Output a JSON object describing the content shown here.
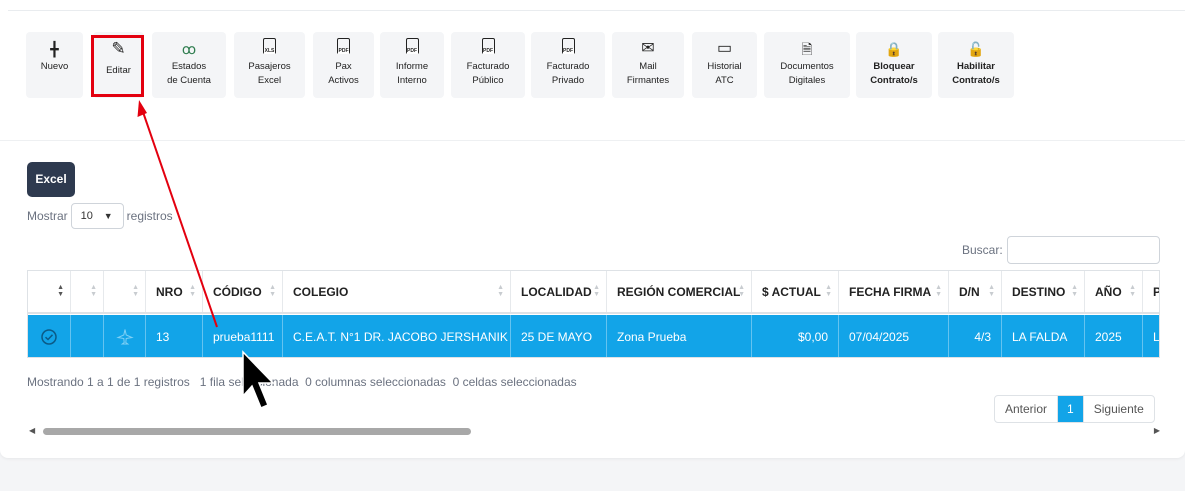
{
  "toolbar": [
    {
      "label": "Nuevo",
      "icon": "plus-icon",
      "glyph": "╋"
    },
    {
      "label": "Editar",
      "icon": "pencil-icon",
      "glyph": "✎"
    },
    {
      "label": "Estados\nde Cuenta",
      "icon": "users-icon",
      "glyph": "ꝏ"
    },
    {
      "label": "Pasajeros\nExcel",
      "icon": "xls-file-icon",
      "glyph": "XLS"
    },
    {
      "label": "Pax\nActivos",
      "icon": "pdf-file-icon",
      "glyph": "PDF"
    },
    {
      "label": "Informe\nInterno",
      "icon": "pdf-file-icon",
      "glyph": "PDF"
    },
    {
      "label": "Facturado\nPúblico",
      "icon": "pdf-file-icon",
      "glyph": "PDF"
    },
    {
      "label": "Facturado\nPrivado",
      "icon": "pdf-file-icon",
      "glyph": "PDF"
    },
    {
      "label": "Mail\nFirmantes",
      "icon": "envelope-icon",
      "glyph": "✉"
    },
    {
      "label": "Historial\nATC",
      "icon": "chat-icon",
      "glyph": "▭"
    },
    {
      "label": "Documentos\nDigitales",
      "icon": "document-icon",
      "glyph": "🗎"
    },
    {
      "label": "Bloquear\nContrato/s",
      "icon": "lock-icon",
      "glyph": "🔒"
    },
    {
      "label": "Habilitar\nContrato/s",
      "icon": "unlock-icon",
      "glyph": "🔓"
    }
  ],
  "excel_label": "Excel",
  "length": {
    "prefix": "Mostrar",
    "value": "10",
    "suffix": "registros"
  },
  "search_label": "Buscar:",
  "columns": [
    "",
    "",
    "",
    "NRO",
    "CÓDIGO",
    "COLEGIO",
    "LOCALIDAD",
    "REGIÓN COMERCIAL",
    "$ ACTUAL",
    "FECHA FIRMA",
    "D/N",
    "DESTINO",
    "AÑO",
    "PL"
  ],
  "row": {
    "nro": "13",
    "codigo": "prueba1111",
    "colegio": "C.E.A.T. N°1 DR. JACOBO JERSHANIK -",
    "localidad": "25 DE MAYO",
    "region": "Zona Prueba",
    "actual": "$0,00",
    "fecha_firma": "07/04/2025",
    "dn": "4/3",
    "destino": "LA FALDA",
    "anio": "2025",
    "pl": "LA"
  },
  "info": "Mostrando 1 a 1 de 1 registros   1 fila seleccionada  0 columnas seleccionadas  0 celdas seleccionadas",
  "pager": {
    "prev": "Anterior",
    "current": "1",
    "next": "Siguiente"
  },
  "colors": {
    "selected_row": "#12a4e8",
    "annotation": "#e3000f",
    "excel_button": "#2e3a4f",
    "lock": "#e3342f",
    "unlock": "#2f7d4f"
  }
}
